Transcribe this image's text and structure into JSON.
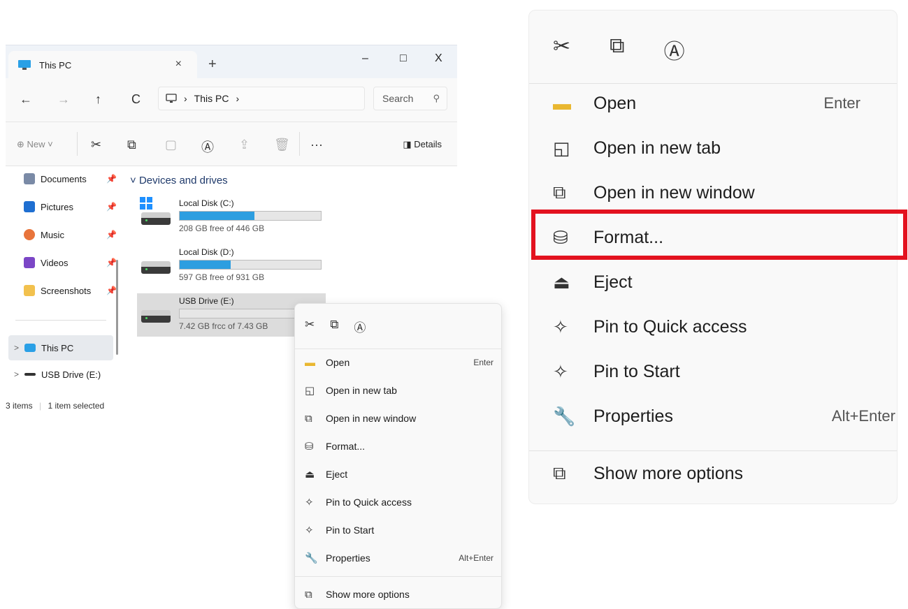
{
  "window": {
    "tab_title": "This PC",
    "tab_close": "×",
    "new_tab": "+",
    "minimize": "–",
    "maximize": "□",
    "close": "X"
  },
  "nav": {
    "back": "←",
    "forward": "→",
    "up": "↑",
    "refresh": "C",
    "breadcrumb_sep": "›",
    "breadcrumb": "This PC",
    "breadcrumb_trailing": "›",
    "search_placeholder": "Search"
  },
  "toolbar": {
    "new_label": "⊕ New ˅",
    "more": "···",
    "details_label": "Details"
  },
  "sidebar": {
    "quick": [
      {
        "label": "Documents",
        "color": "#7a8aa6"
      },
      {
        "label": "Pictures",
        "color": "#1f6fd1"
      },
      {
        "label": "Music",
        "color": "#e8743b"
      },
      {
        "label": "Videos",
        "color": "#7b46c6"
      },
      {
        "label": "Screenshots",
        "color": "#f2c14e"
      }
    ],
    "tree": [
      {
        "label": "This PC",
        "chevron": ">"
      },
      {
        "label": "USB Drive (E:)",
        "chevron": ">"
      }
    ]
  },
  "content": {
    "group_title": "Devices and drives",
    "drives": [
      {
        "name": "Local Disk (C:)",
        "free": "208 GB free of 446 GB",
        "used_fraction": 0.53
      },
      {
        "name": "Local Disk (D:)",
        "free": "597 GB free of 931 GB",
        "used_fraction": 0.36
      },
      {
        "name": "USB Drive (E:)",
        "free": "7.42 GB frcc of 7.43 GB",
        "used_fraction": 0.0
      }
    ]
  },
  "status": {
    "items": "3 items",
    "selected": "1 item selected"
  },
  "context_menu": {
    "items": [
      {
        "label": "Open",
        "shortcut": "Enter",
        "icon": "folder-icon"
      },
      {
        "label": "Open in new tab",
        "shortcut": "",
        "icon": "new-tab-icon"
      },
      {
        "label": "Open in new window",
        "shortcut": "",
        "icon": "new-window-icon"
      },
      {
        "label": "Format...",
        "shortcut": "",
        "icon": "format-icon"
      },
      {
        "label": "Eject",
        "shortcut": "",
        "icon": "eject-icon"
      },
      {
        "label": "Pin to Quick access",
        "shortcut": "",
        "icon": "pin-icon"
      },
      {
        "label": "Pin to Start",
        "shortcut": "",
        "icon": "pin-icon"
      },
      {
        "label": "Properties",
        "shortcut": "Alt+Enter",
        "icon": "wrench-icon"
      }
    ],
    "show_more": "Show more options",
    "highlight_color": "#e3121f"
  },
  "colors": {
    "accent": "#2d9ee0",
    "highlight": "#e3121f"
  }
}
